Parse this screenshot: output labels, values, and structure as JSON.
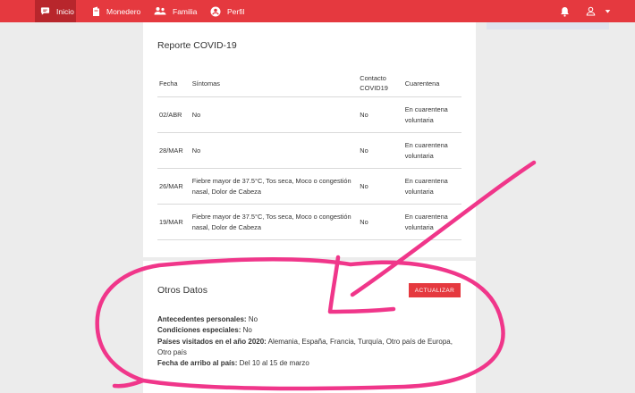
{
  "nav": {
    "items": [
      {
        "label": "Inicio",
        "icon": "chat-bubble-icon",
        "active": true
      },
      {
        "label": "Monedero",
        "icon": "wallet-icon",
        "active": false
      },
      {
        "label": "Familia",
        "icon": "people-icon",
        "active": false
      },
      {
        "label": "Perfil",
        "icon": "account-circle-icon",
        "active": false
      }
    ],
    "right_icons": [
      "bell-icon",
      "user-icon",
      "caret-down-icon"
    ]
  },
  "covid_report": {
    "title": "Reporte COVID-19",
    "columns": [
      "Fecha",
      "Síntomas",
      "Contacto COVID19",
      "Cuarentena"
    ],
    "rows": [
      {
        "fecha": "02/ABR",
        "sintomas": "No",
        "contacto": "No",
        "cuarentena": "En cuarentena voluntaria"
      },
      {
        "fecha": "28/MAR",
        "sintomas": "No",
        "contacto": "No",
        "cuarentena": "En cuarentena voluntaria"
      },
      {
        "fecha": "26/MAR",
        "sintomas": "Fiebre mayor de 37.5°C, Tos seca, Moco o congestión nasal, Dolor de Cabeza",
        "contacto": "No",
        "cuarentena": "En cuarentena voluntaria"
      },
      {
        "fecha": "19/MAR",
        "sintomas": "Fiebre mayor de 37.5°C, Tos seca, Moco o congestión nasal, Dolor de Cabeza",
        "contacto": "No",
        "cuarentena": "En cuarentena voluntaria"
      }
    ]
  },
  "otros_datos": {
    "title": "Otros Datos",
    "button_label": "ACTUALIZAR",
    "antecedentes_label": "Antecedentes personales:",
    "antecedentes_value": "No",
    "condiciones_label": "Condiciones especiales:",
    "condiciones_value": "No",
    "paises_label": "Países visitados en el año 2020:",
    "paises_value": "Alemania, España, Francia, Turquía, Otro país de Europa, Otro país",
    "fecha_label": "Fecha de arribo al país:",
    "fecha_value": "Del 10 al 15 de marzo"
  },
  "colors": {
    "brand_red": "#e5393f",
    "active_red": "#b8262c",
    "annotation_pink": "#f0368a"
  }
}
